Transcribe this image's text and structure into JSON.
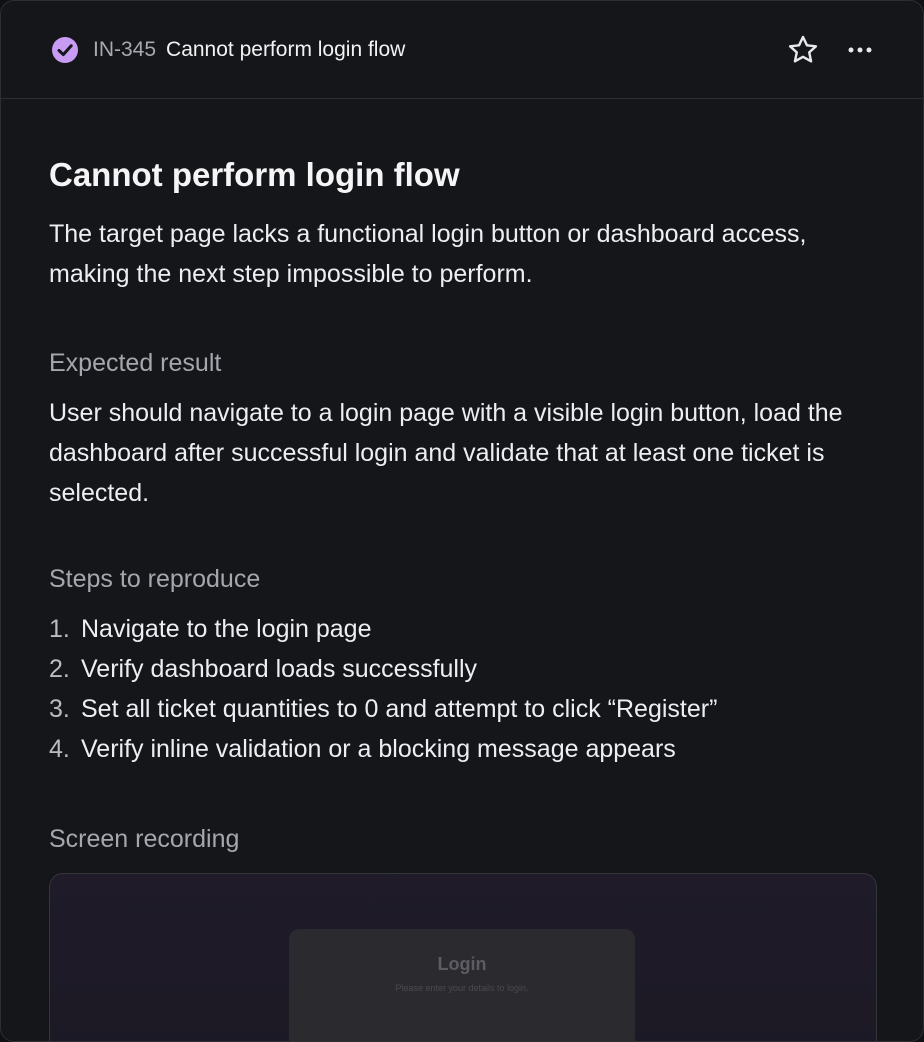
{
  "header": {
    "status_icon": "check-circle-icon",
    "issue_id": "IN-345",
    "title": "Cannot perform login flow",
    "star_icon": "star-icon",
    "more_icon": "more-horizontal-icon"
  },
  "issue": {
    "title": "Cannot perform login flow",
    "description": "The target page lacks a functional login button or dashboard access, making the next step impossible to perform.",
    "expected_label": "Expected result",
    "expected_text": "User should navigate to a login page with a visible login button, load the dashboard after successful login and validate that at least one ticket is selected.",
    "steps_label": "Steps to reproduce",
    "steps": [
      {
        "num": "1.",
        "text": "Navigate to the login page"
      },
      {
        "num": "2.",
        "text": "Verify dashboard loads successfully"
      },
      {
        "num": "3.",
        "text": "Set all ticket quantities to 0 and attempt to click “Register”"
      },
      {
        "num": "4.",
        "text": "Verify inline validation or a blocking message appears"
      }
    ],
    "recording_label": "Screen recording",
    "recording": {
      "login_title": "Login",
      "login_subtitle": "Please enter your details to login."
    }
  },
  "colors": {
    "status_accent": "#c89cf2",
    "background": "#151619",
    "border": "#2c2e33"
  }
}
